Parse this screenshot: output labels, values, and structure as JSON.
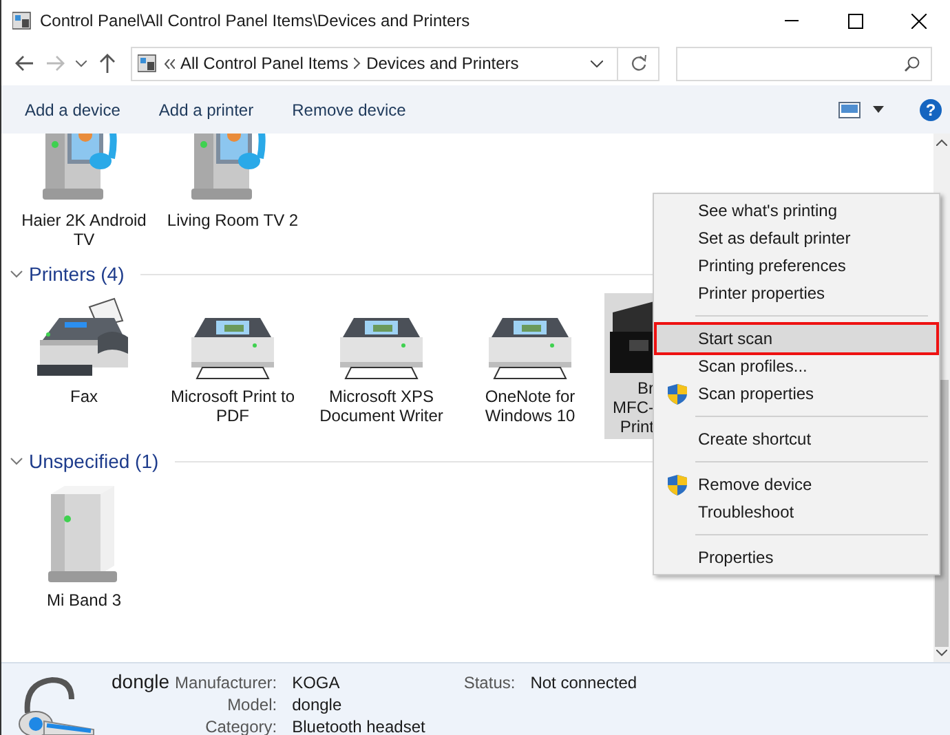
{
  "window": {
    "title": "Control Panel\\All Control Panel Items\\Devices and Printers"
  },
  "address_bar": {
    "crumbs": [
      "All Control Panel Items",
      "Devices and Printers"
    ]
  },
  "toolbar": {
    "buttons": [
      "Add a device",
      "Add a printer",
      "Remove device"
    ],
    "help": "?"
  },
  "groups": [
    {
      "items": [
        {
          "label": "Haier 2K Android TV",
          "kind": "media",
          "selected": false
        },
        {
          "label": "Living Room TV 2",
          "kind": "media",
          "selected": false
        }
      ]
    },
    {
      "header": "Printers (4)",
      "expanded": true,
      "items": [
        {
          "label": "Fax",
          "kind": "fax",
          "selected": false
        },
        {
          "label": "Microsoft Print to PDF",
          "kind": "printer",
          "selected": false
        },
        {
          "label": "Microsoft XPS Document Writer",
          "kind": "printer",
          "selected": false
        },
        {
          "label": "OneNote for Windows 10",
          "kind": "printer",
          "selected": false
        },
        {
          "label": "Br\nMFC-\nPrint",
          "kind": "multifunction",
          "selected": true
        }
      ]
    },
    {
      "header": "Unspecified (1)",
      "expanded": true,
      "items": [
        {
          "label": "Mi Band 3",
          "kind": "box",
          "selected": false
        }
      ]
    }
  ],
  "context_menu": [
    {
      "kind": "item",
      "label": "See what's printing",
      "shield": false,
      "selected": false,
      "outlined": false
    },
    {
      "kind": "item",
      "label": "Set as default printer",
      "shield": false,
      "selected": false,
      "outlined": false
    },
    {
      "kind": "item",
      "label": "Printing preferences",
      "shield": false,
      "selected": false,
      "outlined": false
    },
    {
      "kind": "item",
      "label": "Printer properties",
      "shield": false,
      "selected": false,
      "outlined": false
    },
    {
      "kind": "separator"
    },
    {
      "kind": "item",
      "label": "Start scan",
      "shield": false,
      "selected": true,
      "outlined": true
    },
    {
      "kind": "item",
      "label": "Scan profiles...",
      "shield": false,
      "selected": false,
      "outlined": false
    },
    {
      "kind": "item",
      "label": "Scan properties",
      "shield": true,
      "selected": false,
      "outlined": false
    },
    {
      "kind": "separator"
    },
    {
      "kind": "item",
      "label": "Create shortcut",
      "shield": false,
      "selected": false,
      "outlined": false
    },
    {
      "kind": "separator"
    },
    {
      "kind": "item",
      "label": "Remove device",
      "shield": true,
      "selected": false,
      "outlined": false
    },
    {
      "kind": "item",
      "label": "Troubleshoot",
      "shield": false,
      "selected": false,
      "outlined": false
    },
    {
      "kind": "separator"
    },
    {
      "kind": "item",
      "label": "Properties",
      "shield": false,
      "selected": false,
      "outlined": false
    }
  ],
  "details": {
    "name": "dongle",
    "fields": [
      {
        "label": "Manufacturer:",
        "value": "KOGA"
      },
      {
        "label": "Model:",
        "value": "dongle"
      },
      {
        "label": "Category:",
        "value": "Bluetooth headset"
      }
    ],
    "status_fields": [
      {
        "label": "Status:",
        "value": "Not connected"
      }
    ]
  }
}
